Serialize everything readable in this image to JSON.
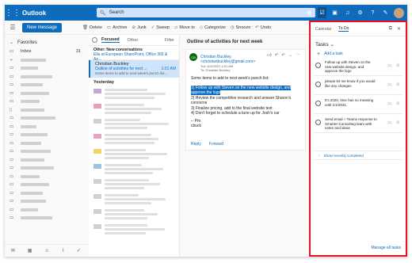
{
  "header": {
    "app_name": "Outlook",
    "search_placeholder": "Search"
  },
  "commands": {
    "new_message": "New message",
    "delete": "Delete",
    "archive": "Archive",
    "junk": "Junk",
    "sweep": "Sweep",
    "move_to": "Move to",
    "categorize": "Categorize",
    "snooze": "Snooze",
    "undo": "Undo"
  },
  "nav": {
    "favorites": "Favorites",
    "inbox": "Inbox",
    "inbox_count": "31"
  },
  "list": {
    "tab_focused": "Focused",
    "tab_other": "Other",
    "filter": "Filter",
    "other_title": "Other: New conversations",
    "other_sub": "Ella at European SharePoint, Office 365 & Az...",
    "sel_sender": "Christian Buckley",
    "sel_subject": "Outline of activities for next ...",
    "sel_time": "1:01 AM",
    "sel_preview": "Some items to add to next week's punch list...",
    "yesterday": "Yesterday"
  },
  "reading": {
    "subject": "Outline of activities for next week",
    "avatar": "CB",
    "sender": "Christian Buckley <christianbuckley@gmail.com>",
    "date": "Tue 11/2/2021 1:01 AM",
    "to": "To: Christian Buckley",
    "intro": "Some items to add to next week's punch list:",
    "item1": "1) Follow up with Steven on the new website design, and approve the logo",
    "item2": "2) Review the competitive research and answer Sharon's concerns",
    "item3": "3) Finalize pricing, add to the final website text",
    "item4": "4) Don't forget to schedule a tune up for Josh's car",
    "sig1": "-- Pm",
    "sig2": "cbuck",
    "reply": "Reply",
    "forward": "Forward"
  },
  "todo": {
    "tab_calendar": "Calendar",
    "tab_todo": "To Do",
    "title": "Tasks",
    "add_task": "Add a task",
    "tasks": [
      "Follow up with Steven on the new website design, and approve the logo",
      "please let me know if you would like any changes",
      "It's 2020, time has no meaning until 1/1/2021.",
      "Send email + Teams response to Smarter-Consulting team with notes and ideas"
    ],
    "show_completed": "Show recently completed",
    "manage": "Manage all tasks"
  }
}
